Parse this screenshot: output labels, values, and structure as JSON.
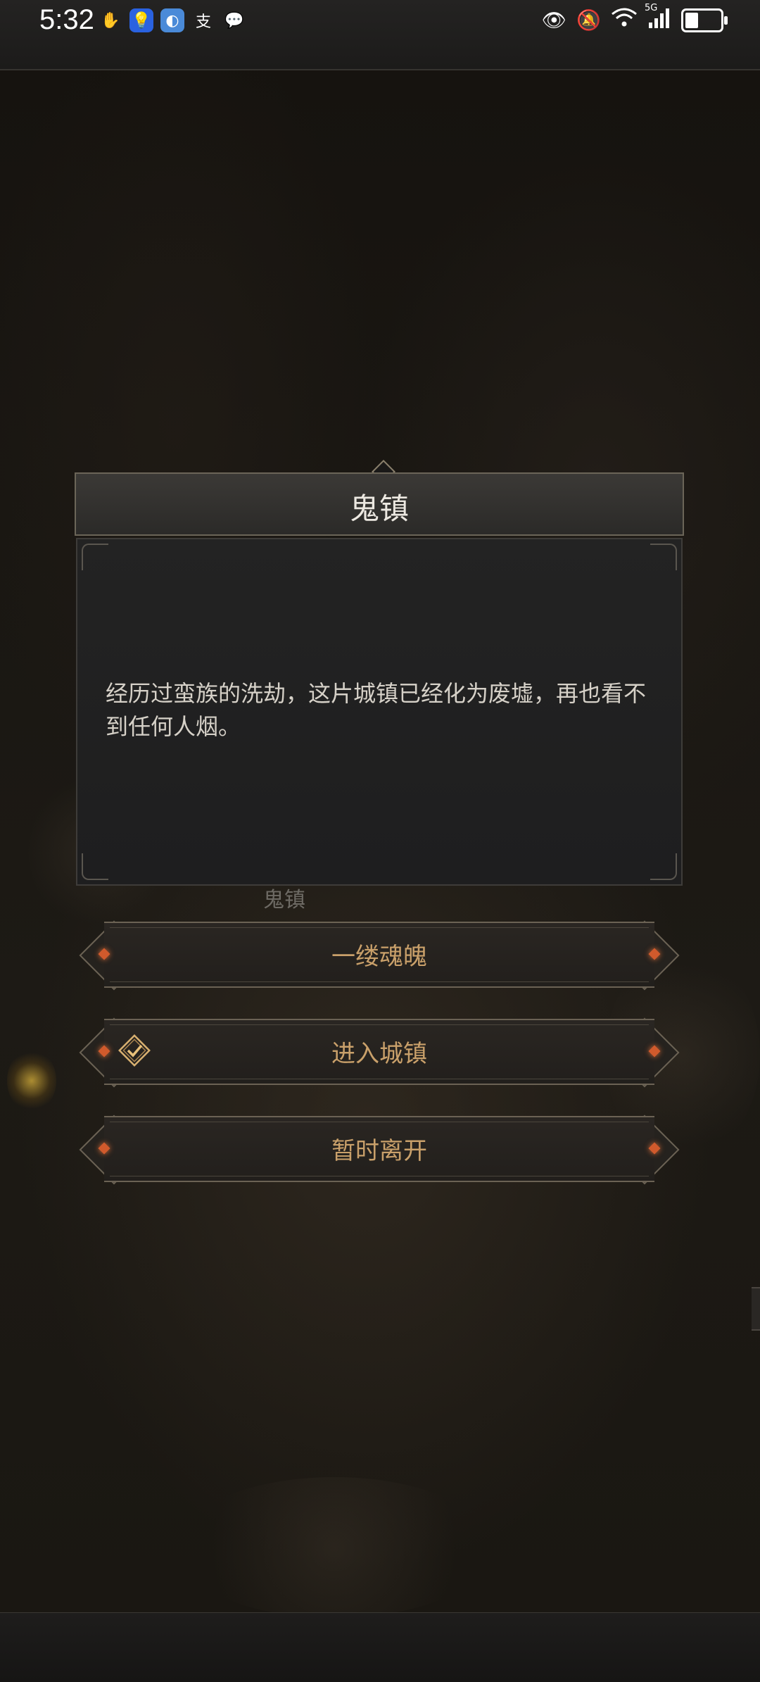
{
  "status_bar": {
    "time": "5:32",
    "network": "5G"
  },
  "scene": {
    "location_label": "鬼镇"
  },
  "dialog": {
    "title": "鬼镇",
    "text": "经历过蛮族的洗劫，这片城镇已经化为废墟，再也看不到任何人烟。"
  },
  "options": [
    {
      "label": "一缕魂魄",
      "icon": ""
    },
    {
      "label": "进入城镇",
      "icon": "check-badge-icon"
    },
    {
      "label": "暂时离开",
      "icon": ""
    }
  ],
  "colors": {
    "option_text": "#c9a06a",
    "gem": "#d05a2c"
  }
}
